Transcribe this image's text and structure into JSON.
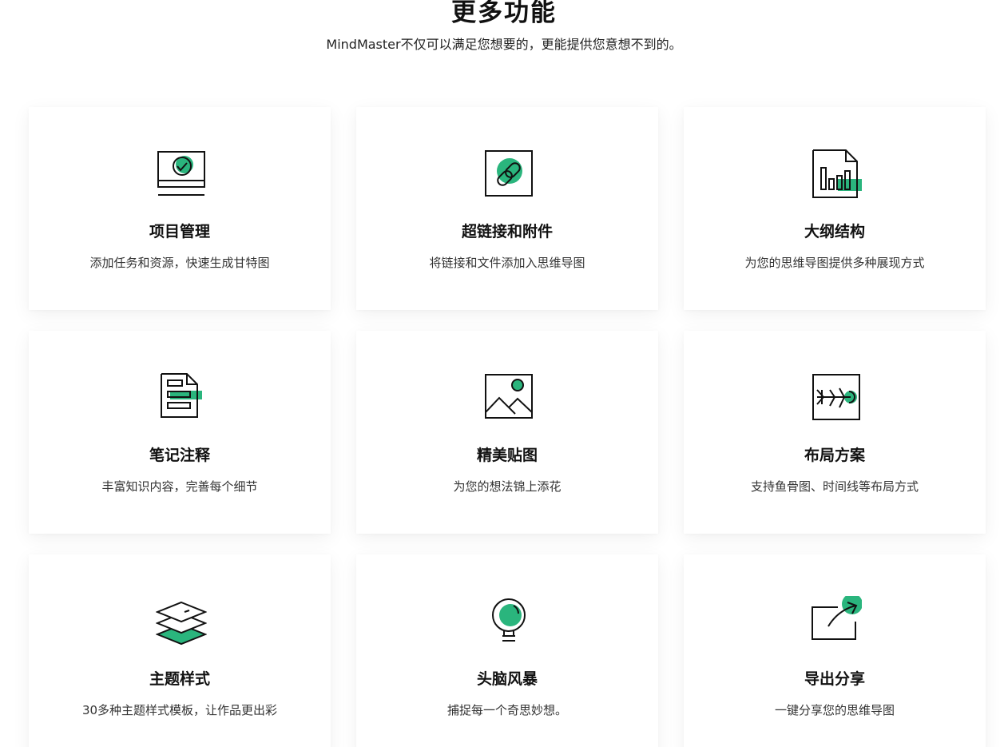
{
  "section": {
    "title": "更多功能",
    "subtitle": "MindMaster不仅可以满足您想要的，更能提供您意想不到的。"
  },
  "colors": {
    "accent": "#2ab57d",
    "stroke": "#111111"
  },
  "features": [
    {
      "title": "项目管理",
      "desc": "添加任务和资源，快速生成甘特图",
      "icon": "project-management-icon"
    },
    {
      "title": "超链接和附件",
      "desc": "将链接和文件添加入思维导图",
      "icon": "hyperlink-icon"
    },
    {
      "title": "大纲结构",
      "desc": "为您的思维导图提供多种展现方式",
      "icon": "outline-chart-icon"
    },
    {
      "title": "笔记注释",
      "desc": "丰富知识内容，完善每个细节",
      "icon": "note-icon"
    },
    {
      "title": "精美贴图",
      "desc": "为您的想法锦上添花",
      "icon": "image-icon"
    },
    {
      "title": "布局方案",
      "desc": "支持鱼骨图、时间线等布局方式",
      "icon": "fishbone-layout-icon"
    },
    {
      "title": "主题样式",
      "desc": "30多种主题样式模板，让作品更出彩",
      "icon": "layers-theme-icon"
    },
    {
      "title": "头脑风暴",
      "desc": "捕捉每一个奇思妙想。",
      "icon": "lightbulb-icon"
    },
    {
      "title": "导出分享",
      "desc": "一键分享您的思维导图",
      "icon": "export-share-icon"
    }
  ]
}
